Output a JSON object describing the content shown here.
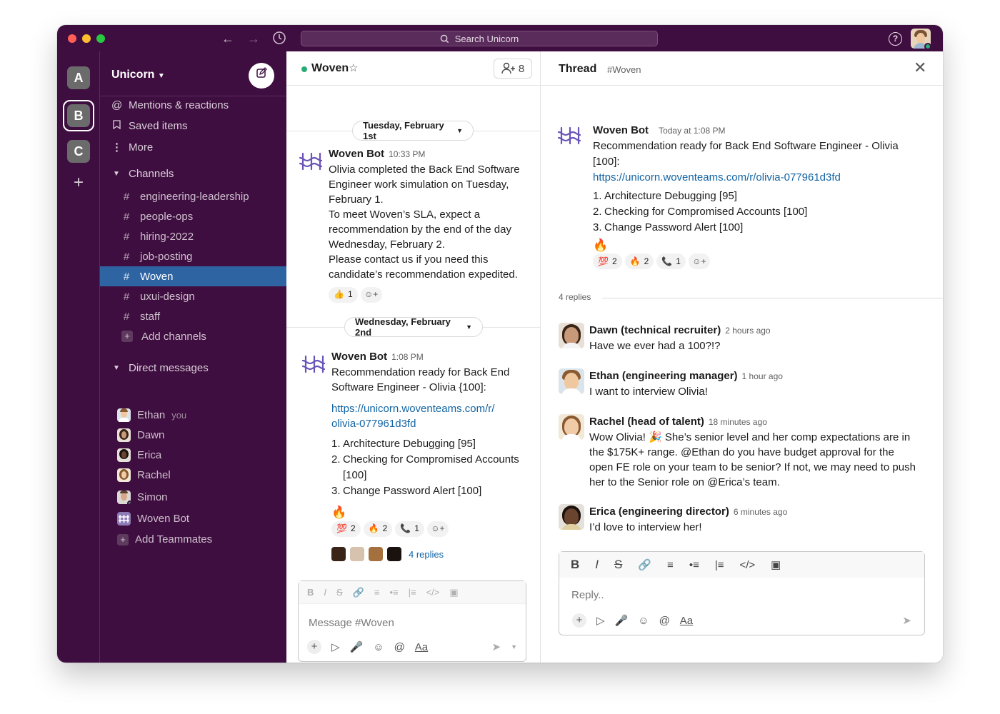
{
  "titlebar": {
    "search_placeholder": "Search Unicorn",
    "help_icon": "?"
  },
  "workspaces": [
    {
      "label": "A"
    },
    {
      "label": "B"
    },
    {
      "label": "C"
    }
  ],
  "sidebar": {
    "team_name": "Unicorn",
    "nav": [
      {
        "label": "Mentions & reactions",
        "icon": "at-icon"
      },
      {
        "label": "Saved items",
        "icon": "bookmark-icon"
      },
      {
        "label": "More",
        "icon": "more-icon"
      }
    ],
    "channels_header": "Channels",
    "channels": [
      "engineering-leadership",
      "people-ops",
      "hiring-2022",
      "job-posting",
      "Woven",
      "uxui-design",
      "staff"
    ],
    "add_channels": "Add channels",
    "dm_header": "Direct messages",
    "dms": [
      {
        "name": "Ethan",
        "suffix": "you"
      },
      {
        "name": "Dawn",
        "suffix": ""
      },
      {
        "name": "Erica",
        "suffix": ""
      },
      {
        "name": "Rachel",
        "suffix": ""
      },
      {
        "name": "Simon",
        "suffix": ""
      },
      {
        "name": "Woven Bot",
        "suffix": ""
      }
    ],
    "add_teammates": "Add Teammates"
  },
  "channel": {
    "name": "Woven",
    "member_count": "8",
    "date1": "Tuesday, February 1st",
    "date2": "Wednesday, February 2nd",
    "msg1": {
      "author": "Woven Bot",
      "time": "10:33 PM",
      "lines": [
        "Olivia completed the Back End Software",
        "Engineer work simulation on Tuesday,",
        "February 1.",
        "To meet Woven’s SLA, expect a",
        "recommendation by the end of the day",
        "Wednesday, February 2.",
        "Please contact us if you need this",
        "candidate’s recommendation expedited."
      ],
      "reactions": [
        {
          "emoji": "👍",
          "count": "1"
        }
      ]
    },
    "msg2": {
      "author": "Woven Bot",
      "time": "1:08 PM",
      "lines": [
        "Recommendation ready for Back End",
        "Software Engineer - Olivia {100]:"
      ],
      "link_lines": [
        "https://unicorn.woventeams.com/r/",
        "olivia-077961d3fd"
      ],
      "items": [
        {
          "n": "1.",
          "text": "Architecture Debugging [95]"
        },
        {
          "n": "2.",
          "text": "Checking for Compromised Accounts"
        },
        {
          "n": "",
          "text": "[100]"
        },
        {
          "n": "3.",
          "text": "Change Password Alert [100]"
        }
      ],
      "emoji": "🔥",
      "reactions": [
        {
          "emoji": "💯",
          "count": "2"
        },
        {
          "emoji": "🔥",
          "count": "2"
        },
        {
          "emoji": "📞",
          "count": "1"
        }
      ],
      "replies": "4 replies"
    },
    "composer_placeholder": "Message #Woven"
  },
  "thread": {
    "title": "Thread",
    "channel": "#Woven",
    "parent": {
      "author": "Woven Bot",
      "time": "Today at 1:08 PM",
      "lines": [
        "Recommendation ready for Back End Software Engineer - Olivia",
        "[100]:"
      ],
      "link": "https://unicorn.woventeams.com/r/olivia-077961d3fd",
      "items": [
        {
          "n": "1.",
          "text": "Architecture Debugging [95]"
        },
        {
          "n": "2.",
          "text": "Checking for Compromised Accounts [100]"
        },
        {
          "n": "3.",
          "text": "Change Password Alert [100]"
        }
      ],
      "emoji": "🔥",
      "reactions": [
        {
          "emoji": "💯",
          "count": "2"
        },
        {
          "emoji": "🔥",
          "count": "2"
        },
        {
          "emoji": "📞",
          "count": "1"
        }
      ]
    },
    "replies_label": "4 replies",
    "replies": [
      {
        "author": "Dawn (technical recruiter)",
        "time": "2 hours ago",
        "lines": [
          "Have we ever had a 100?!?"
        ]
      },
      {
        "author": "Ethan (engineering manager)",
        "time": "1 hour ago",
        "lines": [
          "I want to interview Olivia!"
        ]
      },
      {
        "author": "Rachel (head of talent)",
        "time": "18 minutes ago",
        "lines": [
          "Wow Olivia! 🎉 She’s senior level and her comp expectations are in",
          "the $175K+ range. @Ethan do you have budget approval for the",
          "open FE role on your team to be senior? If not, we may need to push",
          "her to the Senior role on @Erica’s team."
        ]
      },
      {
        "author": "Erica (engineering director)",
        "time": "6 minutes ago",
        "lines": [
          "I’d love to interview her!"
        ]
      }
    ],
    "reply_placeholder": "Reply.."
  },
  "colors": {
    "sidebar": "#3f0e40",
    "active": "#2f64a3",
    "link": "#1264a3",
    "presence": "#2bac76"
  }
}
